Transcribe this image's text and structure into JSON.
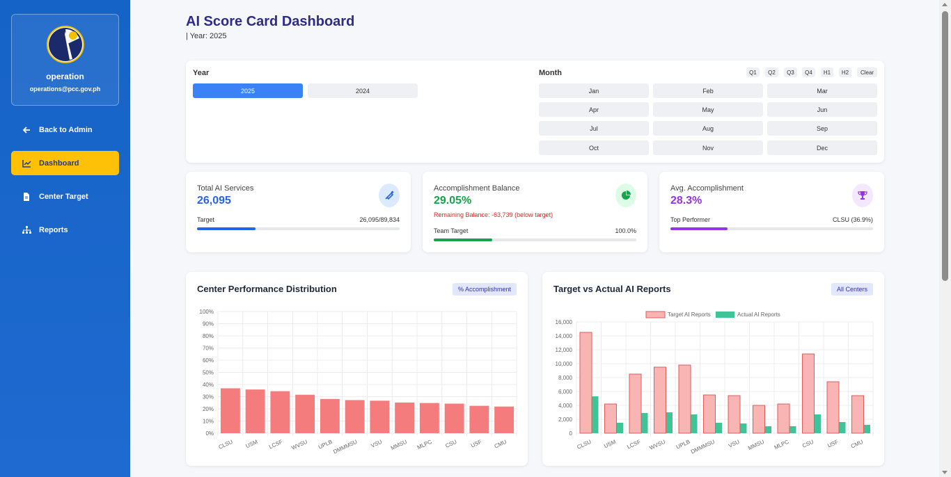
{
  "sidebar": {
    "user_name": "operation",
    "user_email": "operations@pcc.gov.ph",
    "items": [
      {
        "label": "Back to Admin",
        "icon": "arrow-left-icon"
      },
      {
        "label": "Dashboard",
        "icon": "line-chart-icon",
        "active": true
      },
      {
        "label": "Center Target",
        "icon": "document-icon"
      },
      {
        "label": "Reports",
        "icon": "sitemap-icon"
      }
    ]
  },
  "header": {
    "title": "AI Score Card Dashboard",
    "subtitle": "| Year: 2025"
  },
  "filters": {
    "year_label": "Year",
    "years": [
      "2025",
      "2024"
    ],
    "selected_year": "2025",
    "month_label": "Month",
    "quick": [
      "Q1",
      "Q2",
      "Q3",
      "Q4",
      "H1",
      "H2",
      "Clear"
    ],
    "months": [
      "Jan",
      "Feb",
      "Mar",
      "Apr",
      "May",
      "Jun",
      "Jul",
      "Aug",
      "Sep",
      "Oct",
      "Nov",
      "Dec"
    ]
  },
  "stats": {
    "total": {
      "label": "Total AI Services",
      "value": "26,095",
      "row_label": "Target",
      "row_value": "26,095/89,834",
      "progress": 0.29,
      "color": "#2563eb",
      "icon": "syringe-icon"
    },
    "balance": {
      "label": "Accomplishment Balance",
      "value": "29.05%",
      "note": "Remaining Balance: -63,739 (below target)",
      "row_label": "Team Target",
      "row_value": "100.0%",
      "progress": 0.29,
      "color": "#16a34a",
      "icon": "pie-chart-icon"
    },
    "avg": {
      "label": "Avg. Accomplishment",
      "value": "28.3%",
      "row_label": "Top Performer",
      "row_value": "CLSU (36.9%)",
      "progress": 0.283,
      "color": "#9333ea",
      "icon": "trophy-icon"
    }
  },
  "charts": {
    "left": {
      "title": "Center Performance Distribution",
      "badge": "% Accomplishment"
    },
    "right": {
      "title": "Target vs Actual AI Reports",
      "badge": "All Centers"
    }
  },
  "chart_data": [
    {
      "type": "bar",
      "categories": [
        "CLSU",
        "USM",
        "LCSF",
        "WVSU",
        "UPLB",
        "DMMMSU",
        "VSU",
        "MMSU",
        "MLPC",
        "CSU",
        "USF",
        "CMU"
      ],
      "values": [
        36.9,
        35.9,
        34.5,
        31.6,
        28.1,
        27.2,
        26.7,
        25.2,
        24.8,
        24.3,
        22.5,
        21.9
      ],
      "ylim": [
        0,
        100
      ],
      "yticks": [
        "0%",
        "10%",
        "20%",
        "30%",
        "40%",
        "50%",
        "60%",
        "70%",
        "80%",
        "90%",
        "100%"
      ],
      "color": "#f47c7c"
    },
    {
      "type": "bar",
      "categories": [
        "CLSU",
        "USM",
        "LCSF",
        "WVSU",
        "UPLB",
        "DMMMSU",
        "VSU",
        "MMSU",
        "MLPC",
        "CSU",
        "USF",
        "CMU"
      ],
      "series": [
        {
          "name": "Target AI Reports",
          "values": [
            14500,
            4200,
            8500,
            9500,
            9800,
            5500,
            5400,
            4000,
            4200,
            11400,
            7400,
            5400
          ],
          "color": "#f9b4b4",
          "stroke": "#e15b5b"
        },
        {
          "name": "Actual AI Reports",
          "values": [
            5300,
            1500,
            2900,
            3000,
            2700,
            1500,
            1400,
            1000,
            1000,
            2700,
            1600,
            1200
          ],
          "color": "#3ec496"
        }
      ],
      "ylim": [
        0,
        16000
      ],
      "yticks": [
        "0",
        "2,000",
        "4,000",
        "6,000",
        "8,000",
        "10,000",
        "12,000",
        "14,000",
        "16,000"
      ],
      "legend": "top"
    }
  ]
}
